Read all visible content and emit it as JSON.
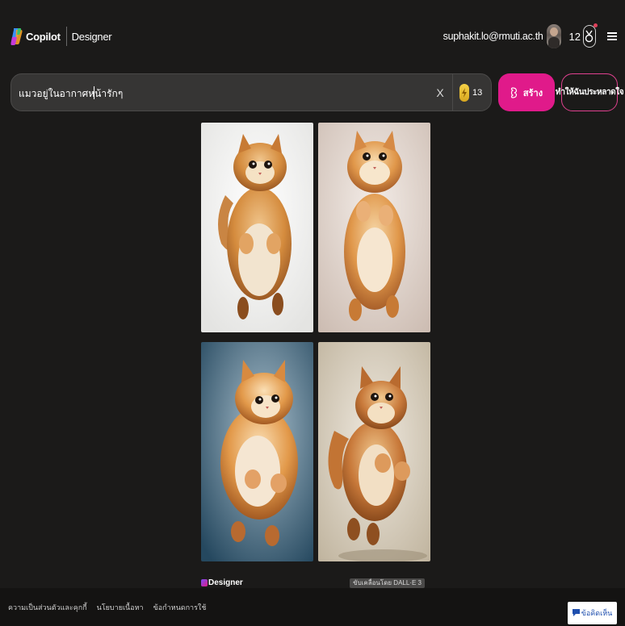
{
  "header": {
    "brand_name": "Copilot",
    "product_name": "Designer",
    "user_email": "suphakit.lo@rmuti.ac.th",
    "reward_points": "12"
  },
  "prompt_bar": {
    "value": "แมวอยู่ในอากาศหน้ารักๆ",
    "clear_label": "X",
    "boosts": "13"
  },
  "actions": {
    "create_label": "สร้าง",
    "surprise_label": "ทำให้ฉันประหลาดใจ"
  },
  "results": {
    "images": [
      {
        "name": "generated-image-1",
        "background": "#f4f4f2"
      },
      {
        "name": "generated-image-2",
        "background": "#e6dcd6"
      },
      {
        "name": "generated-image-3",
        "background": "#5f7c90"
      },
      {
        "name": "generated-image-4",
        "background": "#d8cfbf"
      }
    ],
    "designer_mark": "Designer",
    "model_badge": "ขับเคลื่อนโดย DALL·E 3"
  },
  "footer": {
    "links": [
      "ความเป็นส่วนตัวและคุกกี้",
      "นโยบายเนื้อหา",
      "ข้อกำหนดการใช้"
    ],
    "feedback_label": "ข้อคิดเห็น"
  },
  "colors": {
    "background": "#1b1a19",
    "accent": "#e01a8a",
    "search_bar": "#363534"
  },
  "icons": {
    "logo": "copilot-logo-icon",
    "menu": "hamburger-menu-icon",
    "rewards": "medal-icon",
    "boost": "lightning-coin-icon",
    "create": "sparkle-icon",
    "feedback": "speech-bubble-icon"
  }
}
